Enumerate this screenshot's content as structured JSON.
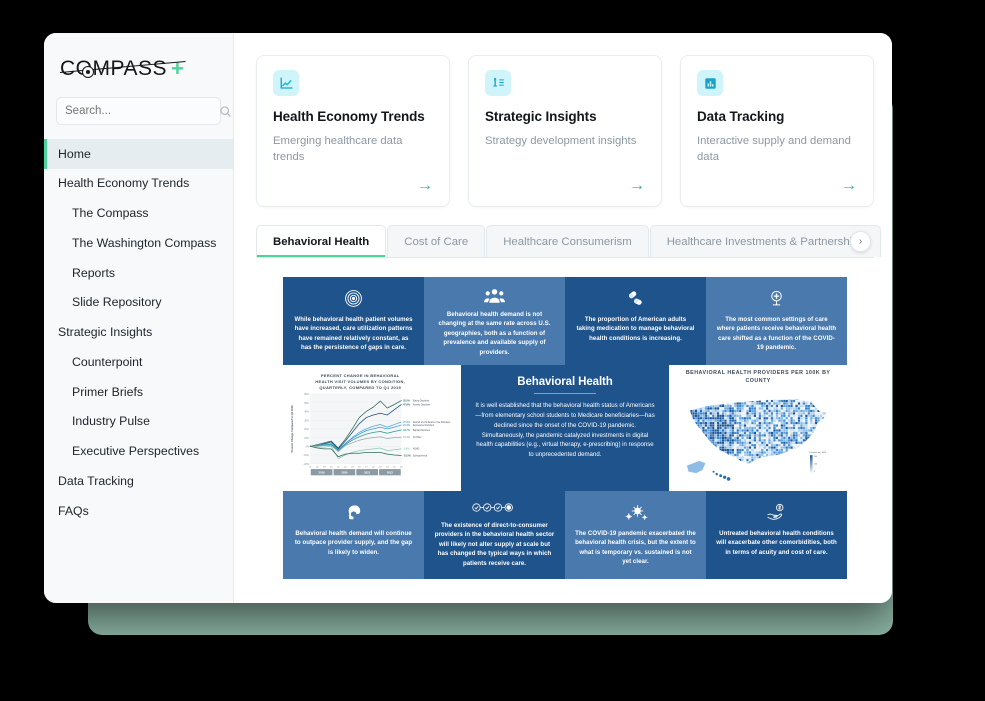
{
  "brand": {
    "logo_text": "COMPASS",
    "logo_plus": "+"
  },
  "search": {
    "placeholder": "Search...",
    "value": "",
    "icon": "search-icon"
  },
  "sidebar": {
    "items": [
      {
        "label": "Home",
        "level": 0,
        "active": true
      },
      {
        "label": "Health Economy Trends",
        "level": 0,
        "active": false
      },
      {
        "label": "The Compass",
        "level": 1,
        "active": false
      },
      {
        "label": "The Washington Compass",
        "level": 1,
        "active": false
      },
      {
        "label": "Reports",
        "level": 1,
        "active": false
      },
      {
        "label": "Slide Repository",
        "level": 1,
        "active": false
      },
      {
        "label": "Strategic Insights",
        "level": 0,
        "active": false
      },
      {
        "label": "Counterpoint",
        "level": 1,
        "active": false
      },
      {
        "label": "Primer Briefs",
        "level": 1,
        "active": false
      },
      {
        "label": "Industry Pulse",
        "level": 1,
        "active": false
      },
      {
        "label": "Executive Perspectives",
        "level": 1,
        "active": false
      },
      {
        "label": "Data Tracking",
        "level": 0,
        "active": false
      },
      {
        "label": "FAQs",
        "level": 0,
        "active": false
      }
    ]
  },
  "cards": [
    {
      "title": "Health Economy Trends",
      "description": "Emerging healthcare data trends",
      "icon": "line-chart-icon",
      "arrow": "→"
    },
    {
      "title": "Strategic Insights",
      "description": "Strategy development insights",
      "icon": "chess-strategy-icon",
      "arrow": "→"
    },
    {
      "title": "Data Tracking",
      "description": "Interactive supply and demand data",
      "icon": "bar-chart-icon",
      "arrow": "→"
    }
  ],
  "tabs": {
    "items": [
      {
        "label": "Behavioral Health",
        "active": true
      },
      {
        "label": "Cost of Care",
        "active": false
      },
      {
        "label": "Healthcare Consumerism",
        "active": false
      },
      {
        "label": "Healthcare Investments & Partnerships",
        "active": false
      }
    ],
    "next_arrow": "›"
  },
  "colors": {
    "accent_green": "#4DD49B",
    "arrow_green": "#2EB67D",
    "card_icon_bg": "#CFF5FA",
    "panel_dark_blue": "#1F538C",
    "panel_light_blue": "#4A7AAD",
    "sage_panel": "#8CB4A5"
  },
  "infographic": {
    "center": {
      "title": "Behavioral Health",
      "body": "It is well established that the behavioral health status of Americans—from elementary school students to Medicare beneficiaries—has declined since the onset of the COVID-19 pandemic. Simultaneously, the pandemic catalyzed investments in digital health capabilities (e.g., virtual therapy, e-prescribing) in response to unprecedented demand."
    },
    "top_panels": [
      {
        "text": "While behavioral health patient volumes have increased, care utilization patterns have remained relatively constant, as has the persistence of gaps in care.",
        "icon": "target-rings-icon",
        "shade": "dark"
      },
      {
        "text": "Behavioral health demand is not changing at the same rate across U.S. geographies, both as a function of prevalence and available supply of providers.",
        "icon": "people-group-icon",
        "shade": "light"
      },
      {
        "text": "The proportion of American adults taking medication to manage behavioral health conditions is increasing.",
        "icon": "pills-icon",
        "shade": "dark"
      },
      {
        "text": "The most common settings of care where patients receive behavioral health care shifted as a function of the COVID-19 pandemic.",
        "icon": "medical-cross-icon",
        "shade": "light"
      }
    ],
    "bottom_panels": [
      {
        "text": "Behavioral health demand will continue to outpace provider supply, and the gap is likely to widen.",
        "icon": "head-profile-icon",
        "shade": "light"
      },
      {
        "text": "The existence of direct-to-consumer providers in the behavioral health sector will likely not alter supply at scale but has changed the typical ways in which patients receive care.",
        "icon": "check-chain-icon",
        "shade": "dark"
      },
      {
        "text": "The COVID-19 pandemic exacerbated the behavioral health crisis, but the extent to what is temporary vs. sustained is not yet clear.",
        "icon": "virus-icon",
        "shade": "light"
      },
      {
        "text": "Untreated behavioral health conditions will exacerbate other comorbidities, both in terms of acuity and cost of care.",
        "icon": "hand-money-icon",
        "shade": "dark"
      }
    ],
    "map": {
      "title": "BEHAVIORAL HEALTH PROVIDERS PER 100K BY COUNTY",
      "legend_title": "Providers per 100K",
      "legend_high": "240",
      "legend_mid": "120",
      "legend_low": "0"
    }
  },
  "chart_data": {
    "type": "line",
    "title": "PERCENT CHANGE IN BEHAVIORAL HEALTH VISIT VOLUMES BY CONDITION, QUARTERLY, COMPARED TO Q1 2019",
    "xlabel": "",
    "ylabel": "Percent Change Compared to Q1 2019",
    "ylim": [
      -20,
      60
    ],
    "yticks": [
      "60%",
      "50%",
      "40%",
      "30%",
      "20%",
      "10%",
      "0%",
      "-10%",
      "-20%"
    ],
    "x": [
      "Q1",
      "Q2",
      "Q3",
      "Q4",
      "Q1",
      "Q2",
      "Q3",
      "Q4",
      "Q1",
      "Q2",
      "Q3",
      "Q4",
      "Q1",
      "Q2"
    ],
    "year_bands": [
      "2019",
      "2020",
      "2021",
      "2022"
    ],
    "series": [
      {
        "name": "Eating Disorders",
        "end_label": "52.5%",
        "color": "#2E6B5E",
        "values": [
          0,
          2,
          4,
          6,
          -2,
          8,
          20,
          33,
          40,
          45,
          52,
          44,
          48,
          52.5
        ]
      },
      {
        "name": "Anxiety Disorders",
        "end_label": "47.9%",
        "color": "#1F4E79",
        "values": [
          0,
          1,
          3,
          5,
          -3,
          6,
          16,
          26,
          33,
          36,
          38,
          36,
          42,
          47.9
        ]
      },
      {
        "name": "Alcohol and Substance Use Disorders",
        "end_label": "27.9%",
        "color": "#4FA8DC",
        "values": [
          0,
          1,
          2,
          3,
          -4,
          3,
          10,
          16,
          20,
          23,
          25,
          22,
          25,
          27.9
        ]
      },
      {
        "name": "Depressive Disorders",
        "end_label": "24.4%",
        "color": "#3E9ED6",
        "values": [
          0,
          1,
          2,
          3,
          -4,
          3,
          9,
          14,
          18,
          20,
          22,
          20,
          22,
          24.4
        ]
      },
      {
        "name": "Bipolar Disorders",
        "end_label": "18.7%",
        "color": "#2E9B8F",
        "values": [
          0,
          1,
          1,
          2,
          -5,
          2,
          7,
          11,
          14,
          16,
          17,
          15,
          17,
          18.7
        ]
      },
      {
        "name": "All Other",
        "end_label": "10.4%",
        "color": "#9AA5AF",
        "values": [
          0,
          0,
          1,
          1,
          -6,
          1,
          4,
          7,
          9,
          10,
          11,
          9,
          10,
          10.4
        ]
      },
      {
        "name": "ADHD",
        "end_label": "-2.9%",
        "color": "#8CCBB5",
        "values": [
          0,
          -1,
          -1,
          0,
          -14,
          -10,
          -7,
          -5,
          -4,
          -3,
          -2,
          -5,
          -4,
          -2.9
        ]
      },
      {
        "name": "Schizophrenia",
        "end_label": "-10.5%",
        "color": "#2E6B5E",
        "values": [
          0,
          -2,
          -3,
          -3,
          -12,
          -9,
          -8,
          -8,
          -7,
          -7,
          -7,
          -9,
          -10,
          -10.5
        ]
      }
    ]
  }
}
